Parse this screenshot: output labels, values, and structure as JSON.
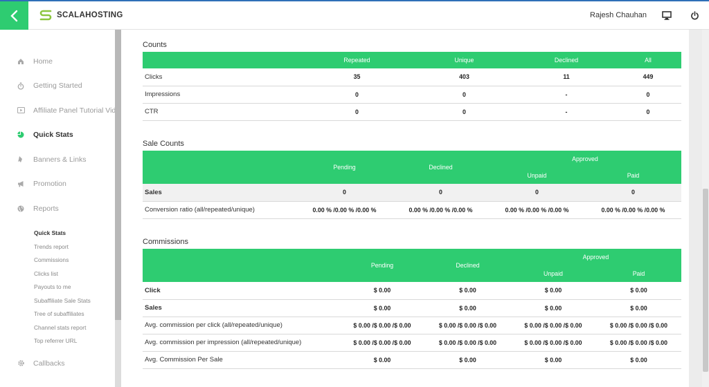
{
  "header": {
    "logo_text": "SCALAHOSTING",
    "user_name": "Rajesh Chauhan",
    "accent_color": "#2ecc71"
  },
  "sidebar": {
    "items": [
      {
        "label": "Home",
        "icon": "home-icon"
      },
      {
        "label": "Getting Started",
        "icon": "stopwatch-icon"
      },
      {
        "label": "Affiliate Panel Tutorial Vide",
        "icon": "video-icon"
      },
      {
        "label": "Quick Stats",
        "icon": "pie-chart-icon",
        "active": true
      },
      {
        "label": "Banners & Links",
        "icon": "link-icon"
      },
      {
        "label": "Promotion",
        "icon": "megaphone-icon"
      },
      {
        "label": "Reports",
        "icon": "globe-icon"
      }
    ],
    "sub_items": [
      {
        "label": "Quick Stats",
        "active": true
      },
      {
        "label": "Trends report"
      },
      {
        "label": "Commissions"
      },
      {
        "label": "Clicks list"
      },
      {
        "label": "Payouts to me"
      },
      {
        "label": "Subaffiliate Sale Stats"
      },
      {
        "label": "Tree of subaffiliates"
      },
      {
        "label": "Channel stats report"
      },
      {
        "label": "Top referrer URL"
      }
    ],
    "bottom_items": [
      {
        "label": "Callbacks",
        "icon": "gear-icon"
      }
    ]
  },
  "counts": {
    "title": "Counts",
    "headers": [
      "Repeated",
      "Unique",
      "Declined",
      "All"
    ],
    "rows": [
      {
        "label": "Clicks",
        "values": [
          "35",
          "403",
          "11",
          "449"
        ]
      },
      {
        "label": "Impressions",
        "values": [
          "0",
          "0",
          "-",
          "0"
        ]
      },
      {
        "label": "CTR",
        "values": [
          "0",
          "0",
          "-",
          "0"
        ]
      }
    ]
  },
  "sale_counts": {
    "title": "Sale Counts",
    "headers": {
      "pending": "Pending",
      "declined": "Declined",
      "approved": "Approved",
      "unpaid": "Unpaid",
      "paid": "Paid"
    },
    "rows": [
      {
        "label": "Sales",
        "values": [
          "0",
          "0",
          "0",
          "0"
        ]
      },
      {
        "label": "Conversion ratio (all/repeated/unique)",
        "values": [
          "0.00 % /0.00 % /0.00 %",
          "0.00 % /0.00 % /0.00 %",
          "0.00 % /0.00 % /0.00 %",
          "0.00 % /0.00 % /0.00 %"
        ]
      }
    ]
  },
  "commissions": {
    "title": "Commissions",
    "headers": {
      "pending": "Pending",
      "declined": "Declined",
      "approved": "Approved",
      "unpaid": "Unpaid",
      "paid": "Paid"
    },
    "rows": [
      {
        "label": "Click",
        "values": [
          "$ 0.00",
          "$ 0.00",
          "$ 0.00",
          "$ 0.00"
        ]
      },
      {
        "label": "Sales",
        "values": [
          "$ 0.00",
          "$ 0.00",
          "$ 0.00",
          "$ 0.00"
        ]
      },
      {
        "label": "Avg. commission per click (all/repeated/unique)",
        "values": [
          "$ 0.00 /$ 0.00 /$ 0.00",
          "$ 0.00 /$ 0.00 /$ 0.00",
          "$ 0.00 /$ 0.00 /$ 0.00",
          "$ 0.00 /$ 0.00 /$ 0.00"
        ]
      },
      {
        "label": "Avg. commission per impression (all/repeated/unique)",
        "values": [
          "$ 0.00 /$ 0.00 /$ 0.00",
          "$ 0.00 /$ 0.00 /$ 0.00",
          "$ 0.00 /$ 0.00 /$ 0.00",
          "$ 0.00 /$ 0.00 /$ 0.00"
        ]
      },
      {
        "label": "Avg. Commission Per Sale",
        "values": [
          "$ 0.00",
          "$ 0.00",
          "$ 0.00",
          "$ 0.00"
        ]
      }
    ]
  }
}
